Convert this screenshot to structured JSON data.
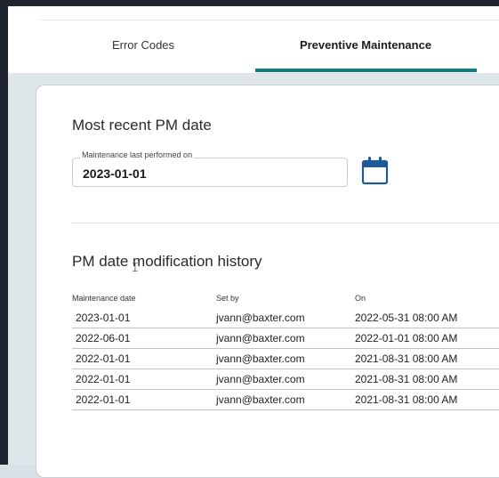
{
  "tabs": [
    {
      "label": "Error Codes",
      "active": false
    },
    {
      "label": "Preventive Maintenance",
      "active": true
    }
  ],
  "recent": {
    "title": "Most recent PM date",
    "field_label": "Maintenance last performed on",
    "field_value": "2023-01-01",
    "icon": "calendar-icon"
  },
  "history": {
    "title": "PM date modification history",
    "columns": [
      "Maintenance date",
      "Set by",
      "On"
    ],
    "rows": [
      [
        "2023-01-01",
        "jvann@baxter.com",
        "2022-05-31 08:00 AM"
      ],
      [
        "2022-06-01",
        "jvann@baxter.com",
        "2022-01-01 08:00 AM"
      ],
      [
        "2022-01-01",
        "jvann@baxter.com",
        "2021-08-31 08:00 AM"
      ],
      [
        "2022-01-01",
        "jvann@baxter.com",
        "2021-08-31 08:00 AM"
      ],
      [
        "2022-01-01",
        "jvann@baxter.com",
        "2021-08-31 08:00 AM"
      ]
    ]
  },
  "colors": {
    "accent": "#0f7f82",
    "icon": "#1f5a96"
  }
}
